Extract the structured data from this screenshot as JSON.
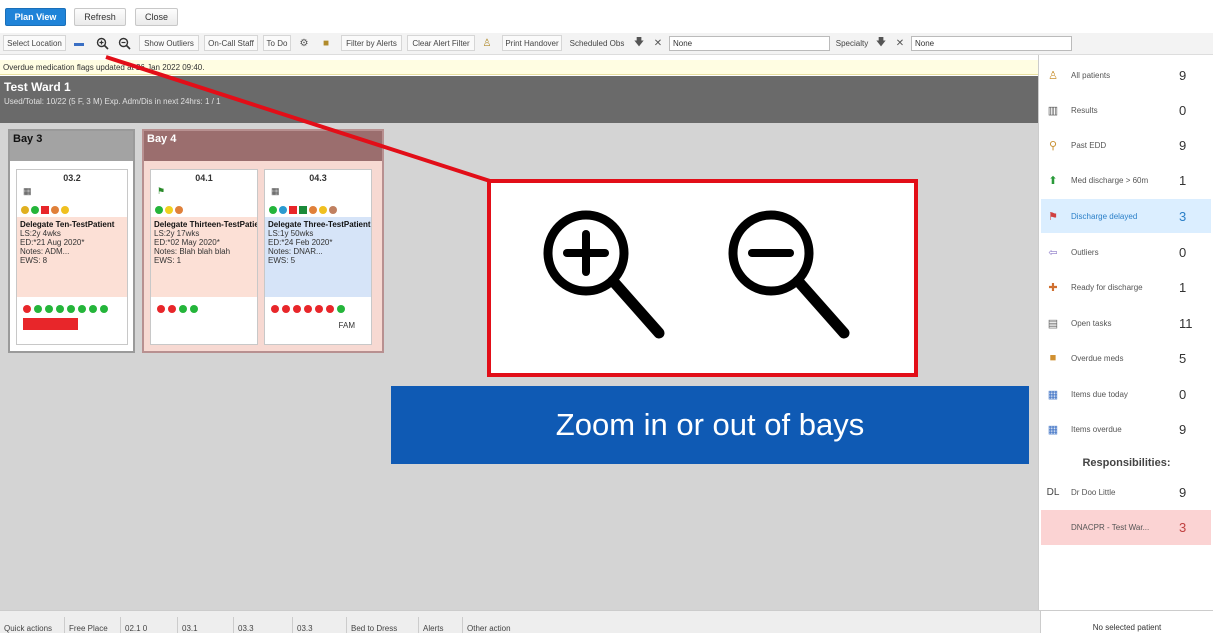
{
  "top_buttons": {
    "plan_view": "Plan View",
    "refresh": "Refresh",
    "close": "Close"
  },
  "toolbar": {
    "select_location": "Select Location",
    "show_outliers": "Show Outliers",
    "on_call_staff": "On-Call Staff",
    "to_do": "To Do",
    "filter_by_alerts": "Filter by Alerts",
    "clear_alert_filter": "Clear Alert Filter",
    "print_handover": "Print Handover",
    "scheduled_obs_label": "Scheduled Obs",
    "scheduled_obs_value": "None",
    "specialty_label": "Specialty",
    "specialty_value": "None"
  },
  "notice": "Overdue medication flags updated at 26 Jan 2022 09:40.",
  "ward": {
    "title": "Test Ward 1",
    "subtitle": "Used/Total: 10/22 (5 F, 3 M) Exp. Adm/Dis in next 24hrs: 1 / 1"
  },
  "bays": [
    {
      "name": "Bay 3"
    },
    {
      "name": "Bay 4"
    }
  ],
  "beds": [
    {
      "number": "03.2",
      "patient": "Delegate Ten-TestPatient",
      "ls": "LS:2y 4wks",
      "ed": "ED:*21 Aug 2020*",
      "notes": "Notes: ADM...",
      "ews": "EWS: 8",
      "tag": ""
    },
    {
      "number": "04.1",
      "patient": "Delegate Thirteen-TestPatient",
      "ls": "LS:2y 17wks",
      "ed": "ED:*02 May 2020*",
      "notes": "Notes: Blah blah blah",
      "ews": "EWS: 1",
      "tag": ""
    },
    {
      "number": "04.3",
      "patient": "Delegate Three-TestPatient",
      "ls": "LS:1y 50wks",
      "ed": "ED:*24 Feb 2020*",
      "notes": "Notes: DNAR...",
      "ews": "EWS: 5",
      "tag": "FAM"
    }
  ],
  "side_panel": {
    "items": [
      {
        "label": "All patients",
        "count": "9"
      },
      {
        "label": "Results",
        "count": "0"
      },
      {
        "label": "Past EDD",
        "count": "9"
      },
      {
        "label": "Med discharge > 60m",
        "count": "1"
      },
      {
        "label": "Discharge delayed",
        "count": "3"
      },
      {
        "label": "Outliers",
        "count": "0"
      },
      {
        "label": "Ready for discharge",
        "count": "1"
      },
      {
        "label": "Open tasks",
        "count": "11"
      },
      {
        "label": "Overdue meds",
        "count": "5"
      },
      {
        "label": "Items due today",
        "count": "0"
      },
      {
        "label": "Items overdue",
        "count": "9"
      }
    ],
    "responsibilities_label": "Responsibilities:",
    "responsibilities": [
      {
        "prefix": "DL",
        "label": "Dr Doo Little",
        "count": "9"
      },
      {
        "prefix": "",
        "label": "DNACPR - Test War...",
        "count": "3"
      }
    ]
  },
  "bottom_bar": {
    "quick_actions": "Quick actions",
    "items": [
      "Free Place",
      "02.1 0",
      "03.1",
      "03.3",
      "03.3",
      "Bed to Dress",
      "Alerts",
      "Other action"
    ],
    "no_patient": "No selected patient"
  },
  "annotation": {
    "banner": "Zoom in or out of bays"
  },
  "colors": {
    "callout_red": "#e20e18",
    "banner_blue": "#0f5ab4",
    "primary_button": "#1f83d8"
  },
  "icons": [
    "folder-icon",
    "zoom-in-icon",
    "zoom-out-icon",
    "gear-icon",
    "bag-icon",
    "person-icon",
    "arrow-down-icon",
    "clear-x-icon"
  ]
}
